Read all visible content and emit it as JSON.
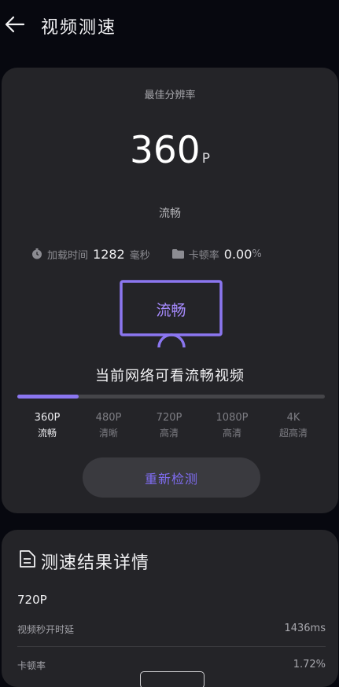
{
  "header": {
    "title": "视频测速"
  },
  "test": {
    "best_label": "最佳分辨率",
    "resolution_value": "360",
    "resolution_unit": "P",
    "quality": "流畅",
    "load_time_label": "加载时间",
    "load_time_value": "1282",
    "load_time_unit": "毫秒",
    "stall_label": "卡顿率",
    "stall_value": "0.00",
    "stall_unit": "%",
    "tv_label": "流畅",
    "description": "当前网络可看流畅视频",
    "progress_fraction": 0.2,
    "levels": [
      {
        "res": "360P",
        "quality": "流畅"
      },
      {
        "res": "480P",
        "quality": "清晰"
      },
      {
        "res": "720P",
        "quality": "高清"
      },
      {
        "res": "1080P",
        "quality": "高清"
      },
      {
        "res": "4K",
        "quality": "超高清"
      }
    ],
    "active_level": 0,
    "retest_label": "重新检测"
  },
  "details": {
    "title": "测速结果详情",
    "resolution": "720P",
    "rows": [
      {
        "label": "视频秒开时延",
        "value": "1436ms"
      },
      {
        "label": "卡顿率",
        "value": "1.72%"
      }
    ]
  },
  "colors": {
    "accent": "#8b76f0",
    "card": "#242428",
    "background": "#07080f"
  },
  "icons": [
    "back-arrow-icon",
    "clock-icon",
    "folder-icon",
    "tv-icon",
    "document-icon"
  ]
}
